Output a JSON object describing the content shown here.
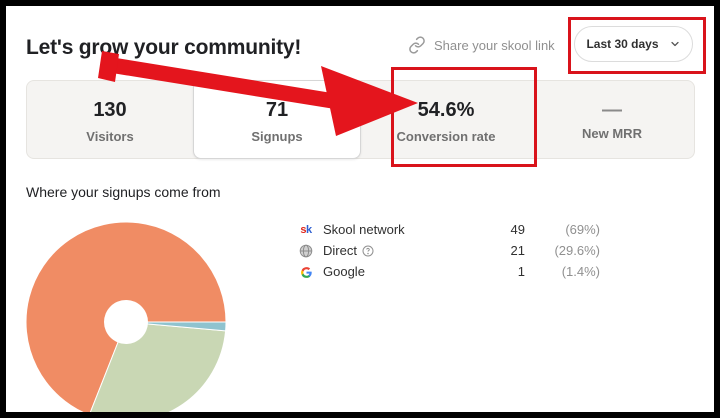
{
  "header": {
    "title": "Let's grow your community!",
    "share_label": "Share your skool link",
    "range_label": "Last 30 days"
  },
  "stats": [
    {
      "value": "130",
      "label": "Visitors"
    },
    {
      "value": "71",
      "label": "Signups"
    },
    {
      "value": "54.6%",
      "label": "Conversion rate"
    },
    {
      "value": "—",
      "label": "New MRR"
    }
  ],
  "sources": {
    "title": "Where your signups come from",
    "items": [
      {
        "name": "Skool network",
        "count": "49",
        "percent": "(69%)",
        "icon": "skool-logo-icon",
        "color": "#f08c64"
      },
      {
        "name": "Direct",
        "count": "21",
        "percent": "(29.6%)",
        "icon": "globe-icon",
        "color": "#c9d7b4"
      },
      {
        "name": "Google",
        "count": "1",
        "percent": "(1.4%)",
        "icon": "google-g-icon",
        "color": "#8fc3cf"
      }
    ]
  },
  "chart_data": {
    "type": "pie",
    "categories": [
      "Skool network",
      "Direct",
      "Google"
    ],
    "values": [
      49,
      21,
      1
    ],
    "colors": [
      "#f08c64",
      "#c9d7b4",
      "#8fc3cf"
    ]
  },
  "icons": {
    "share": "link-icon",
    "range": "chevron-down-icon",
    "direct_info": "help-circle-icon"
  },
  "annotation_color": "#d9131b"
}
